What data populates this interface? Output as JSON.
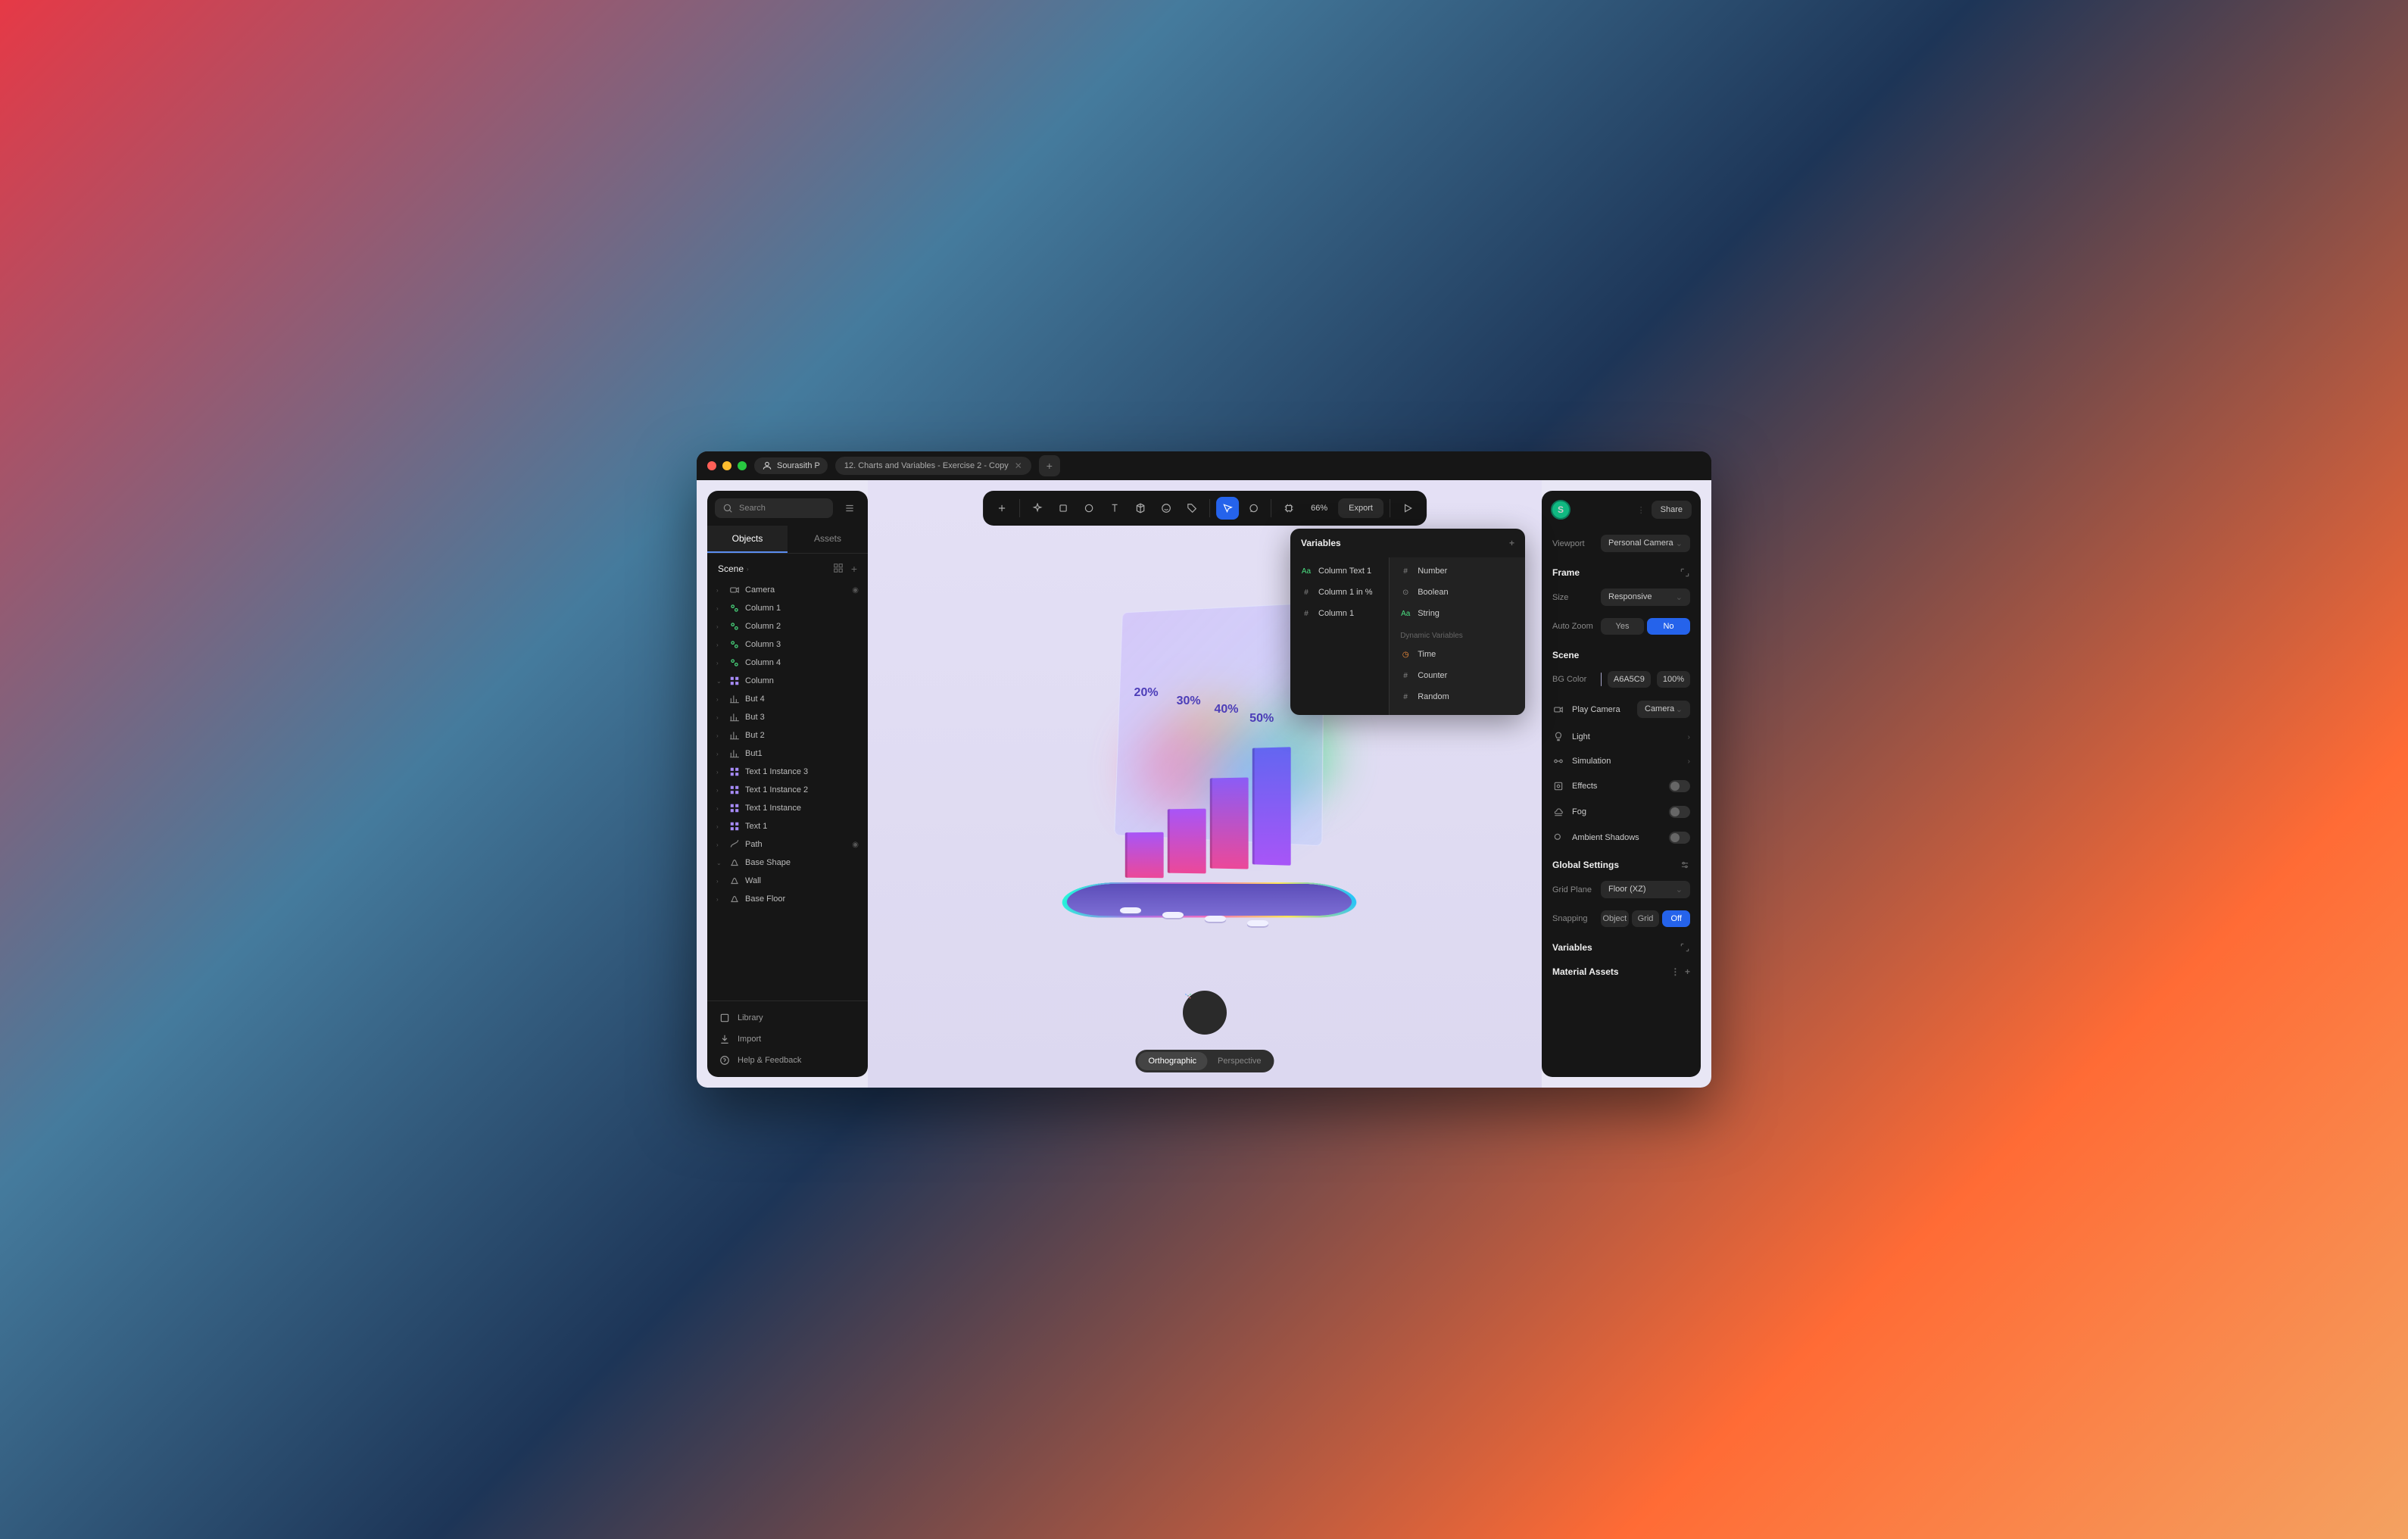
{
  "titlebar": {
    "user": "Sourasith P",
    "tab": "12. Charts and Variables - Exercise 2 - Copy"
  },
  "sidebar": {
    "search_placeholder": "Search",
    "tabs": {
      "objects": "Objects",
      "assets": "Assets"
    },
    "scene_label": "Scene",
    "tree": [
      {
        "name": "Camera",
        "icon": "camera",
        "eye": true
      },
      {
        "name": "Column 1",
        "icon": "group"
      },
      {
        "name": "Column 2",
        "icon": "group"
      },
      {
        "name": "Column 3",
        "icon": "group"
      },
      {
        "name": "Column 4",
        "icon": "group"
      },
      {
        "name": "Column",
        "icon": "grid",
        "expand": true
      },
      {
        "name": "But 4",
        "icon": "chart"
      },
      {
        "name": "But 3",
        "icon": "chart"
      },
      {
        "name": "But 2",
        "icon": "chart"
      },
      {
        "name": "But1",
        "icon": "chart"
      },
      {
        "name": "Text 1 Instance 3",
        "icon": "grid"
      },
      {
        "name": "Text 1 Instance 2",
        "icon": "grid"
      },
      {
        "name": "Text 1 Instance",
        "icon": "grid"
      },
      {
        "name": "Text 1",
        "icon": "grid"
      },
      {
        "name": "Path",
        "icon": "path",
        "eye": true
      },
      {
        "name": "Base Shape",
        "icon": "shape",
        "expand": true
      },
      {
        "name": "Wall",
        "icon": "shape"
      },
      {
        "name": "Base Floor",
        "icon": "shape"
      }
    ],
    "footer": {
      "library": "Library",
      "import": "Import",
      "help": "Help & Feedback"
    }
  },
  "toolbar": {
    "zoom": "66%",
    "export": "Export"
  },
  "canvas": {
    "labels": [
      "20%",
      "30%",
      "40%",
      "50%"
    ],
    "cam_modes": {
      "ortho": "Orthographic",
      "persp": "Perspective"
    }
  },
  "variables_panel": {
    "title": "Variables",
    "left": [
      {
        "name": "Column Text 1",
        "type": "string"
      },
      {
        "name": "Column 1 in %",
        "type": "number"
      },
      {
        "name": "Column 1",
        "type": "number"
      }
    ],
    "right_types": [
      {
        "name": "Number",
        "icon": "hash"
      },
      {
        "name": "Boolean",
        "icon": "toggle"
      },
      {
        "name": "String",
        "icon": "text"
      }
    ],
    "dynamic_label": "Dynamic Variables",
    "dynamic": [
      {
        "name": "Time",
        "icon": "clock"
      },
      {
        "name": "Counter",
        "icon": "hash"
      },
      {
        "name": "Random",
        "icon": "hash"
      }
    ]
  },
  "rightbar": {
    "avatar": "S",
    "share": "Share",
    "viewport_label": "Viewport",
    "viewport_value": "Personal Camera",
    "frame": {
      "title": "Frame",
      "size_label": "Size",
      "size_value": "Responsive",
      "autozoom_label": "Auto Zoom",
      "yes": "Yes",
      "no": "No"
    },
    "scene": {
      "title": "Scene",
      "bgcolor_label": "BG Color",
      "bgcolor_value": "A6A5C9",
      "bgcolor_opacity": "100%"
    },
    "play_camera": "Play Camera",
    "camera_value": "Camera",
    "items": {
      "light": "Light",
      "simulation": "Simulation",
      "effects": "Effects",
      "fog": "Fog",
      "ambient": "Ambient Shadows"
    },
    "global": {
      "title": "Global Settings",
      "gridplane_label": "Grid Plane",
      "gridplane_value": "Floor (XZ)",
      "snapping_label": "Snapping",
      "object": "Object",
      "grid": "Grid",
      "off": "Off"
    },
    "variables_title": "Variables",
    "materials_title": "Material Assets"
  },
  "chart_data": {
    "type": "bar",
    "categories": [
      "Column 1",
      "Column 2",
      "Column 3",
      "Column 4"
    ],
    "values": [
      20,
      30,
      40,
      50
    ],
    "labels": [
      "20%",
      "30%",
      "40%",
      "50%"
    ],
    "title": "",
    "xlabel": "",
    "ylabel": "",
    "ylim": [
      0,
      100
    ]
  }
}
